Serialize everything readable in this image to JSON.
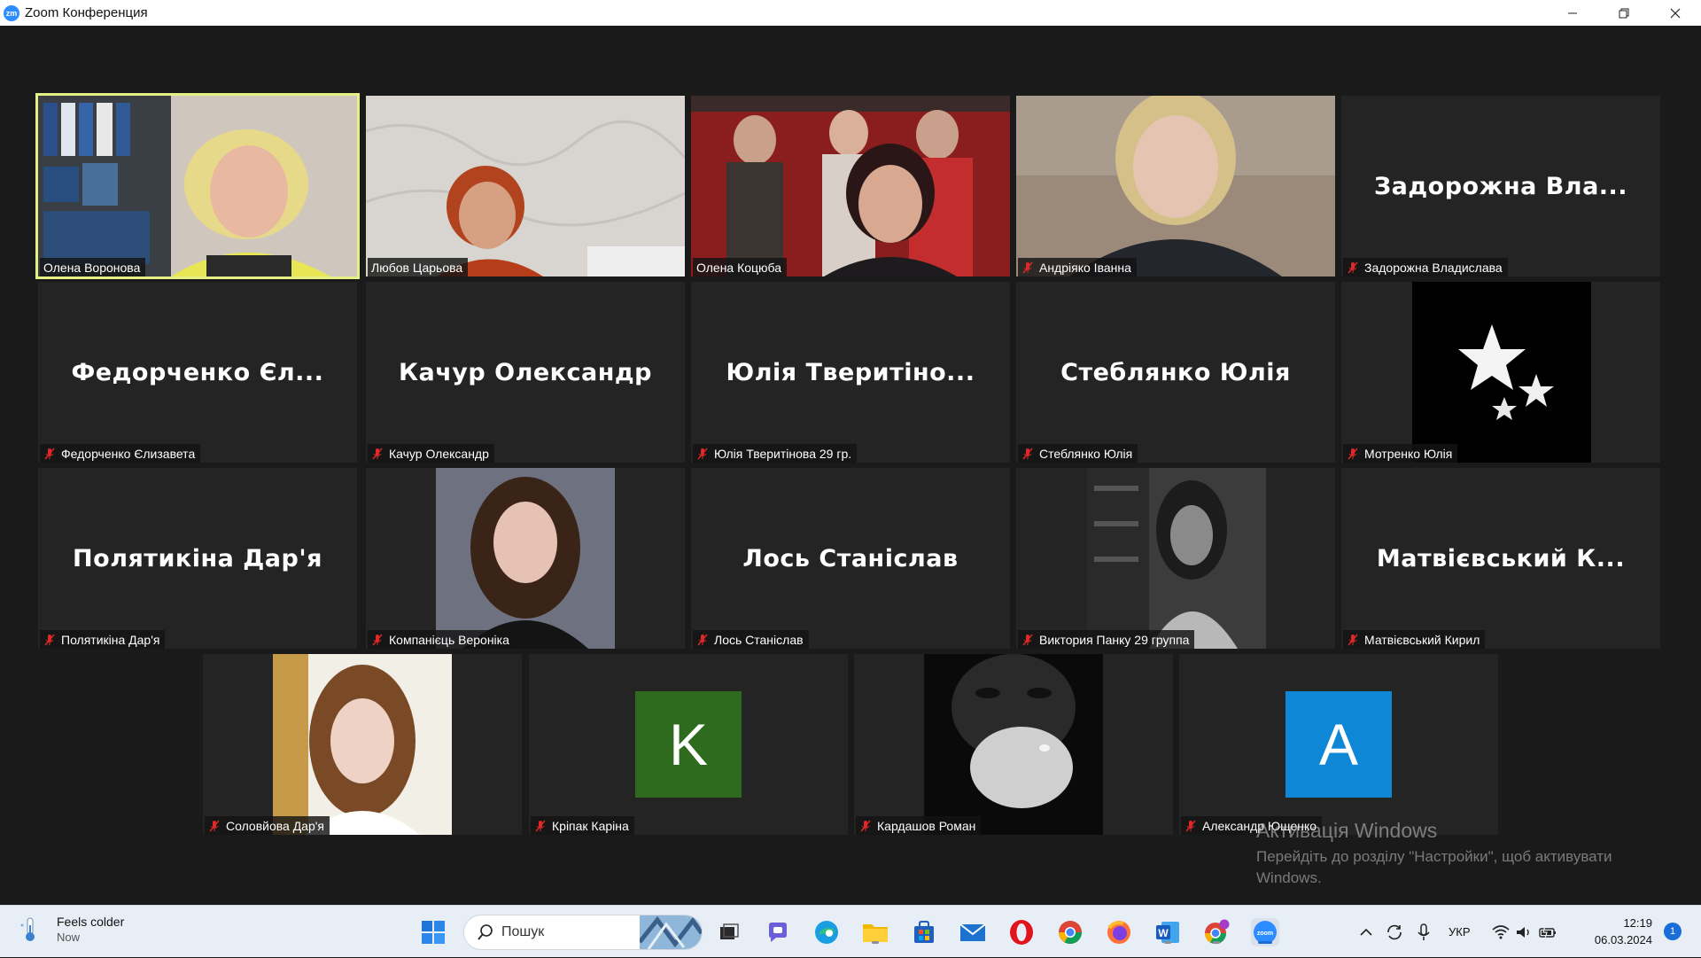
{
  "window": {
    "title": "Zoom Конференция",
    "app_icon": "zm"
  },
  "participants": [
    {
      "label": "Олена Воронова",
      "display": "video",
      "muted": false
    },
    {
      "label": "Любов Царьова",
      "display": "video",
      "muted": false
    },
    {
      "label": "Олена Коцюба",
      "display": "video",
      "muted": false
    },
    {
      "label": "Андріяко Іванна",
      "display": "video",
      "muted": true
    },
    {
      "label": "Задорожна Владислава",
      "display": "name",
      "center": "Задорожна  Вла...",
      "muted": true
    },
    {
      "label": "Федорченко Єлизавета",
      "display": "name",
      "center": "Федорченко Єл...",
      "muted": true
    },
    {
      "label": "Качур Олександр",
      "display": "name",
      "center": "Качур Олександр",
      "muted": true
    },
    {
      "label": "Юлія Тверитінова 29 гр.",
      "display": "name",
      "center": "Юлія  Тверитіно...",
      "muted": true
    },
    {
      "label": "Стеблянко Юлія",
      "display": "name",
      "center": "Стеблянко Юлія",
      "muted": true
    },
    {
      "label": "Мотренко Юлія",
      "display": "picture",
      "muted": true
    },
    {
      "label": "Полятикіна Дар'я",
      "display": "name",
      "center": "Полятикіна Дар'я",
      "muted": true
    },
    {
      "label": "Компанієць Вероніка",
      "display": "picture",
      "muted": true
    },
    {
      "label": "Лось Станіслав",
      "display": "name",
      "center": "Лось Станіслав",
      "muted": true
    },
    {
      "label": "Виктория Панку 29 группа",
      "display": "picture",
      "muted": true
    },
    {
      "label": "Матвієвський Кирил",
      "display": "name",
      "center": "Матвієвський К...",
      "muted": true
    },
    {
      "label": "Соловйова Дар'я",
      "display": "picture",
      "muted": true
    },
    {
      "label": "Кріпак Каріна",
      "display": "avatar",
      "initial": "K",
      "avatar_color": "#2e6b1f",
      "muted": true
    },
    {
      "label": "Кардашов Роман",
      "display": "picture",
      "muted": true
    },
    {
      "label": "Александр Ющенко",
      "display": "avatar",
      "initial": "A",
      "avatar_color": "#0e87d6",
      "muted": true
    }
  ],
  "active_speaker": "Олена Воронова",
  "watermark": {
    "title": "Активація Windows",
    "subtitle": "Перейдіть до розділу \"Настройки\", щоб активувати Windows."
  },
  "taskbar": {
    "weather_main": "Feels colder",
    "weather_sub": "Now",
    "search_placeholder": "Пошук",
    "language": "УКР",
    "time": "12:19",
    "date": "06.03.2024",
    "notifications": "1",
    "pinned": [
      "windows-start",
      "search",
      "task-view",
      "teams-chat",
      "edge",
      "file-explorer",
      "microsoft-store",
      "mail",
      "opera",
      "chrome",
      "firefox",
      "word",
      "chrome-profile",
      "zoom"
    ]
  },
  "colors": {
    "active_speaker_border": "#e4ef86",
    "tile_bg": "#242424",
    "meeting_bg": "#1a1a1a",
    "muted_icon": "#e02828"
  }
}
